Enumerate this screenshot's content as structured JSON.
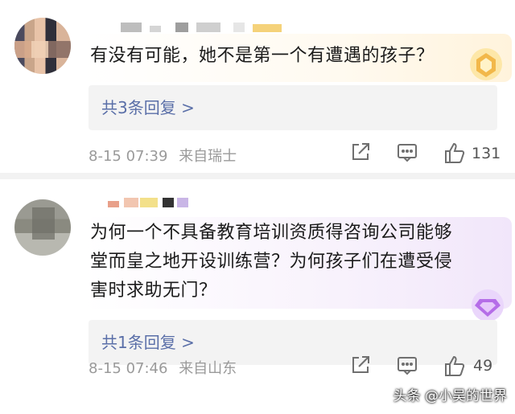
{
  "comments": [
    {
      "text": "有没有可能，她不是第一个有遭遇的孩子？",
      "replies_label": "共3条回复 >",
      "date": "8-15 07:39",
      "source": "来自瑞士",
      "like_count": "131",
      "badge_color": "#f2b84a"
    },
    {
      "text": "为何一个不具备教育培训资质得咨询公司能够堂而皇之地开设训练营？为何孩子们在遭受侵害时求助无门？",
      "replies_label": "共1条回复 >",
      "date": "8-15 07:46",
      "source": "来自山东",
      "like_count": "49",
      "badge_color": "#b56de8"
    }
  ],
  "watermark": "头条 @小吴的世界",
  "colors": {
    "reply_link": "#5a6fa8",
    "meta_text": "#9a9a9a",
    "divider": "#f2f2f2"
  },
  "icons": [
    "share-icon",
    "comment-icon",
    "like-icon",
    "gold-badge-icon",
    "purple-badge-icon"
  ]
}
